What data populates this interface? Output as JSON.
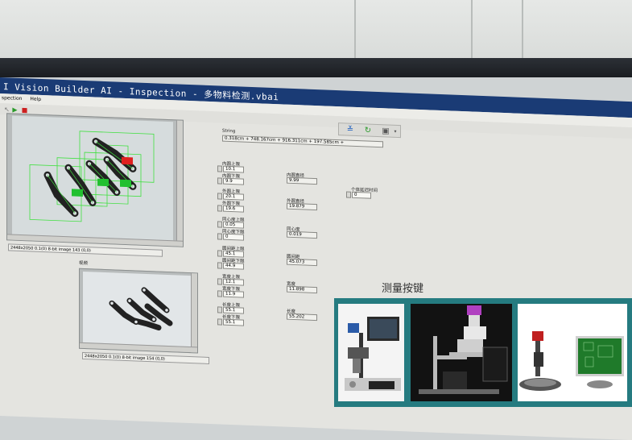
{
  "window": {
    "title": "I Vision Builder AI - Inspection - 多物料检测.vbai"
  },
  "menu": {
    "items": [
      "spection",
      "Help"
    ]
  },
  "view1": {
    "status": "2448x2050 0.1(0) 8-bit image 143 (0,0)"
  },
  "view2": {
    "title": "视频",
    "status": "2448x2050 0.1(0) 8-bit image 154 (0,0)"
  },
  "string_indicator": {
    "label": "String",
    "value": "0.318cm + 748.167cm + 916.311cm + 197.585cm +"
  },
  "controls": [
    {
      "label": "内圆上限",
      "value": "10.1"
    },
    {
      "label": "内圆下限",
      "value": "9.9"
    },
    {
      "label": "外圆上限",
      "value": "20.1"
    },
    {
      "label": "外圆下限",
      "value": "19.6"
    },
    {
      "label": "同心度上限",
      "value": "0.05"
    },
    {
      "label": "同心度下限",
      "value": "0"
    },
    {
      "label": "圆间距上限",
      "value": "45.1"
    },
    {
      "label": "圆间距下限",
      "value": "44.9"
    },
    {
      "label": "宽度上限",
      "value": "12.1"
    },
    {
      "label": "宽度下限",
      "value": "11.9"
    },
    {
      "label": "长度上限",
      "value": "55.1"
    },
    {
      "label": "长度下限",
      "value": "55.1"
    }
  ],
  "indicators": [
    {
      "label": "内圆直径",
      "value": "9.99"
    },
    {
      "label": "外圆直径",
      "value": "19.879"
    },
    {
      "label": "同心度",
      "value": "0.019"
    },
    {
      "label": "圆间距",
      "value": "45.073"
    },
    {
      "label": "宽度",
      "value": "11.898"
    },
    {
      "label": "长度",
      "value": "55.202"
    }
  ],
  "extra_control": {
    "label": "个体延迟时间",
    "value": "0"
  },
  "measure_button": {
    "label": "测量按键"
  },
  "colors": {
    "titlebar": "#1a3b75",
    "overlay": "#257b80",
    "fail": "#e02020",
    "pass": "#22c030",
    "roi": "#40e040"
  }
}
